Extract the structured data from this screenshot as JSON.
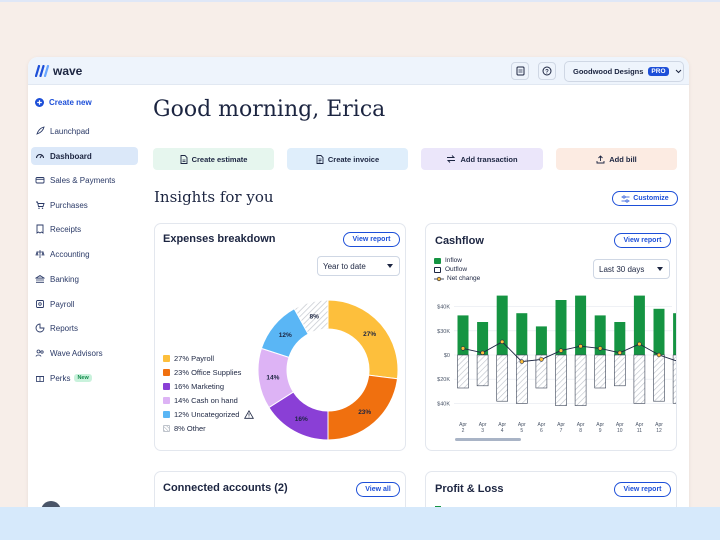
{
  "brand": {
    "name": "wave"
  },
  "header": {
    "company": "Goodwood Designs",
    "plan_badge": "PRO",
    "icons": [
      "receipt-icon",
      "help-icon",
      "chevron-down-icon"
    ]
  },
  "sidebar": {
    "create_label": "Create new",
    "items": [
      {
        "label": "Launchpad",
        "icon": "rocket-icon"
      },
      {
        "label": "Dashboard",
        "icon": "dashboard-icon",
        "active": true
      },
      {
        "label": "Sales & Payments",
        "icon": "card-icon"
      },
      {
        "label": "Purchases",
        "icon": "cart-icon"
      },
      {
        "label": "Receipts",
        "icon": "receipt-icon"
      },
      {
        "label": "Accounting",
        "icon": "scale-icon"
      },
      {
        "label": "Banking",
        "icon": "bank-icon"
      },
      {
        "label": "Payroll",
        "icon": "payroll-icon"
      },
      {
        "label": "Reports",
        "icon": "reports-icon"
      },
      {
        "label": "Wave Advisors",
        "icon": "advisors-icon"
      },
      {
        "label": "Perks",
        "icon": "gift-icon",
        "badge": "New"
      }
    ]
  },
  "main": {
    "greeting": "Good morning, Erica",
    "quick_actions": [
      {
        "label": "Create estimate",
        "color": "#e6f6ee"
      },
      {
        "label": "Create invoice",
        "color": "#dfeefb"
      },
      {
        "label": "Add transaction",
        "color": "#ebe6fa"
      },
      {
        "label": "Add bill",
        "color": "#fcebe2"
      }
    ],
    "insights_title": "Insights for you",
    "customize_label": "Customize"
  },
  "expenses": {
    "title": "Expenses breakdown",
    "view_report": "View report",
    "period": "Year to date",
    "legend": [
      {
        "label": "27% Payroll",
        "color": "#fdbf3c"
      },
      {
        "label": "23% Office Supplies",
        "color": "#f0700f"
      },
      {
        "label": "16% Marketing",
        "color": "#8a3fd6"
      },
      {
        "label": "14% Cash on hand",
        "color": "#ddb3f5"
      },
      {
        "label": "12% Uncategorized",
        "color": "#5ab6f5"
      },
      {
        "label": "8% Other",
        "color": "hatched"
      }
    ],
    "slice_labels": [
      "27%",
      "23%",
      "16%",
      "14%",
      "12%",
      "8%"
    ]
  },
  "cashflow": {
    "title": "Cashflow",
    "view_report": "View report",
    "period": "Last 30 days",
    "legend": [
      "Inflow",
      "Outflow",
      "Net change"
    ],
    "y_ticks": [
      "$40K",
      "$30K",
      "$0",
      "$20K",
      "$40K"
    ],
    "x_labels": [
      {
        "m": "Apr",
        "d": "2"
      },
      {
        "m": "Apr",
        "d": "3"
      },
      {
        "m": "Apr",
        "d": "4"
      },
      {
        "m": "Apr",
        "d": "5"
      },
      {
        "m": "Apr",
        "d": "6"
      },
      {
        "m": "Apr",
        "d": "7"
      },
      {
        "m": "Apr",
        "d": "8"
      },
      {
        "m": "Apr",
        "d": "9"
      },
      {
        "m": "Apr",
        "d": "10"
      },
      {
        "m": "Apr",
        "d": "11"
      },
      {
        "m": "Apr",
        "d": "12"
      }
    ]
  },
  "chart_data": [
    {
      "type": "pie",
      "title": "Expenses breakdown",
      "categories": [
        "Payroll",
        "Office Supplies",
        "Marketing",
        "Cash on hand",
        "Uncategorized",
        "Other"
      ],
      "values": [
        27,
        23,
        16,
        14,
        12,
        8
      ],
      "colors": [
        "#fdbf3c",
        "#f0700f",
        "#8a3fd6",
        "#ddb3f5",
        "#5ab6f5",
        "hatched"
      ]
    },
    {
      "type": "bar",
      "title": "Cashflow",
      "categories": [
        "Apr 2",
        "Apr 3",
        "Apr 4",
        "Apr 5",
        "Apr 6",
        "Apr 7",
        "Apr 8",
        "Apr 9",
        "Apr 10",
        "Apr 11",
        "Apr 12"
      ],
      "series": [
        {
          "name": "Inflow",
          "values": [
            18,
            15,
            27,
            19,
            13,
            25,
            27,
            18,
            15,
            27,
            21,
            19
          ]
        },
        {
          "name": "Outflow",
          "values": [
            -15,
            -14,
            -21,
            -22,
            -15,
            -23,
            -23,
            -15,
            -14,
            -22,
            -21,
            -22
          ]
        },
        {
          "name": "Net change",
          "values": [
            3,
            1,
            6,
            -3,
            -2,
            2,
            4,
            3,
            1,
            5,
            0,
            -3
          ]
        }
      ],
      "ylim": [
        -22,
        30
      ],
      "grid": true,
      "legend": "top-left"
    }
  ]
}
